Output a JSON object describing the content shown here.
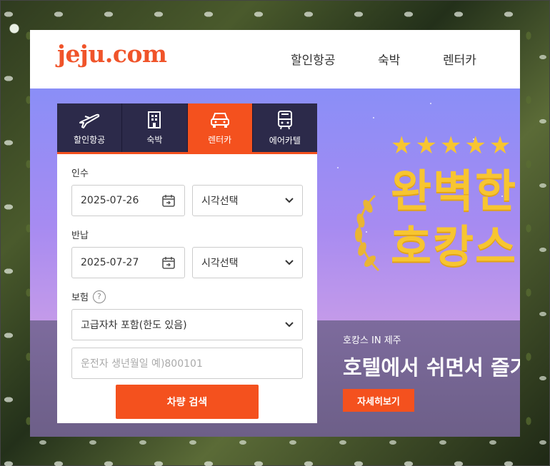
{
  "site": {
    "logo": "jeju.com"
  },
  "nav": {
    "items": [
      "할인항공",
      "숙박",
      "렌터카"
    ]
  },
  "tabs": [
    {
      "label": "할인항공",
      "icon": "airplane-icon"
    },
    {
      "label": "숙박",
      "icon": "building-icon"
    },
    {
      "label": "렌터카",
      "icon": "car-icon",
      "active": true
    },
    {
      "label": "에어카텔",
      "icon": "bus-icon"
    }
  ],
  "form": {
    "pickup_label": "인수",
    "pickup_date": "2025-07-26",
    "pickup_time": "시각선택",
    "return_label": "반납",
    "return_date": "2025-07-27",
    "return_time": "시각선택",
    "insurance_label": "보험",
    "help_mark": "?",
    "insurance_value": "고급자차 포함(한도 있음)",
    "birth_placeholder": "운전자 생년월일 예)800101",
    "search_label": "차량 검색"
  },
  "hero": {
    "stars": "★★★★★",
    "title_line1": "완벽한",
    "title_line2": "호캉스",
    "subtitle": "호캉스 IN 제주",
    "headline": "호텔에서 쉬면서 즐기",
    "button": "자세히보기"
  },
  "colors": {
    "accent": "#f4511e",
    "tab_dark": "#2c2a4a",
    "gold": "#f7c531"
  }
}
